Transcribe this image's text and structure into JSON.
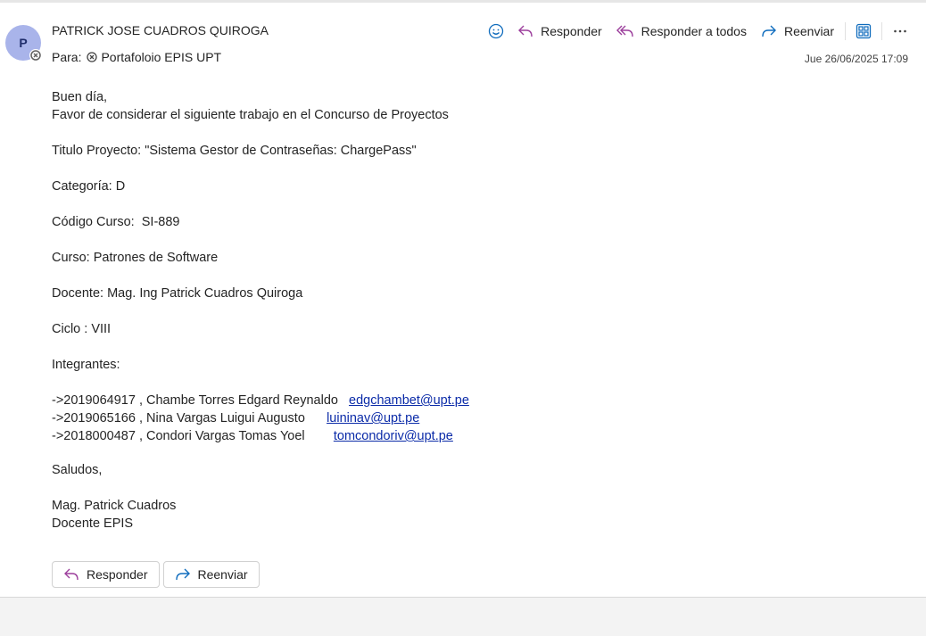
{
  "header": {
    "avatar_initial": "P",
    "sender_name": "PATRICK JOSE CUADROS QUIROGA",
    "to_label": "Para:",
    "recipient": "Portafoloio EPIS UPT",
    "date": "Jue 26/06/2025 17:09"
  },
  "toolbar": {
    "reply_label": "Responder",
    "reply_all_label": "Responder a todos",
    "forward_label": "Reenviar",
    "icons": [
      "emoji-icon",
      "reply-icon",
      "reply-all-icon",
      "forward-icon",
      "immersive-reader-icon",
      "more-icon"
    ]
  },
  "body": {
    "greeting": "Buen día,",
    "intro": "Favor de considerar el siguiente trabajo en el Concurso de Proyectos",
    "project_title": "Titulo Proyecto: \"Sistema Gestor de Contraseñas: ChargePass\"",
    "category": "Categoría: D",
    "course_code": "Código Curso:  SI-889",
    "course": "Curso: Patrones de Software",
    "teacher": "Docente: Mag. Ing Patrick Cuadros Quiroga",
    "cycle": "Ciclo : VIII",
    "members_label": "Integrantes:",
    "members": [
      {
        "text": "->2019064917 , Chambe Torres Edgard Reynaldo   ",
        "email": "edgchambet@upt.pe"
      },
      {
        "text": "->2019065166 , Nina Vargas Luigui Augusto      ",
        "email": "luininav@upt.pe"
      },
      {
        "text": "->2018000487 , Condori Vargas Tomas Yoel        ",
        "email": "tomcondoriv@upt.pe"
      }
    ],
    "closing": "Saludos,",
    "signature_name": "Mag. Patrick Cuadros",
    "signature_title": "Docente EPIS"
  },
  "actions": {
    "reply_label": "Responder",
    "forward_label": "Reenviar"
  },
  "colors": {
    "avatar_bg": "#a9b4ea",
    "accent_blue": "#0f6cbd",
    "reply_purple": "#9b3d9b",
    "link": "#0b2ba8"
  }
}
